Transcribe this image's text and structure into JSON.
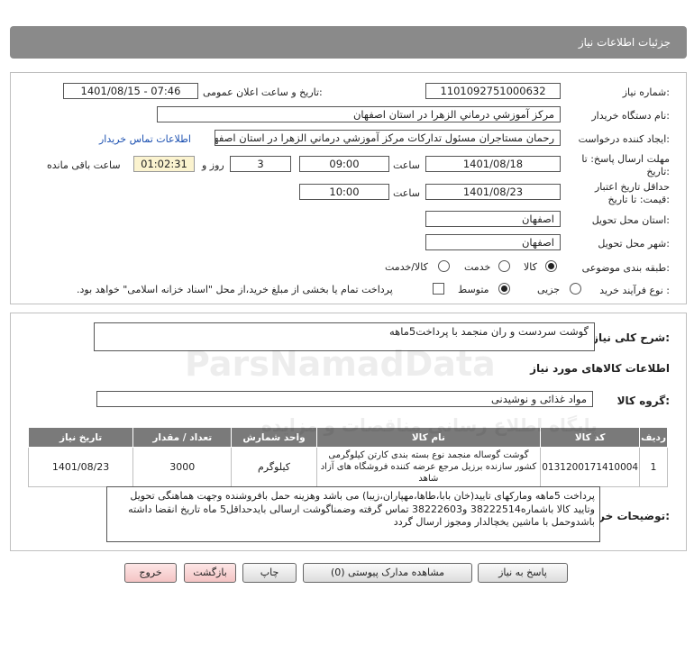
{
  "header": {
    "title": "جزئیات اطلاعات نیاز"
  },
  "form": {
    "need_number_label": "شماره نیاز:",
    "need_number": "1101092751000632",
    "announce_label": "تاریخ و ساعت اعلان عمومی:",
    "announce_value": "1401/08/15 - 07:46",
    "buyer_org_label": "نام دستگاه خریدار:",
    "buyer_org": "مرکز آموزشي درماني الزهرا در استان اصفهان",
    "creator_label": "ایجاد کننده درخواست:",
    "creator": "رحمان مستاجران مسئول تداركات مركز آموزشي درماني الزهرا در استان اصفهان",
    "buyer_contact_link": "اطلاعات تماس خریدار",
    "deadline_label_1": "مهلت ارسال پاسخ: تا",
    "deadline_label_2": "تاریخ:",
    "deadline_date": "1401/08/18",
    "time_label": "ساعت",
    "deadline_time": "09:00",
    "days_value": "3",
    "days_label": "روز و",
    "remaining_time": "01:02:31",
    "remaining_label": "ساعت باقی مانده",
    "validity_label_1": "حداقل تاریخ اعتبار",
    "validity_label_2": "قیمت: تا تاریخ:",
    "validity_date": "1401/08/23",
    "validity_time_label": "ساعت",
    "validity_time": "10:00",
    "delivery_province_label": "استان محل تحویل:",
    "delivery_province": "اصفهان",
    "delivery_city_label": "شهر محل تحویل:",
    "delivery_city": "اصفهان",
    "category_label": "طبقه بندی موضوعی:",
    "category_options": [
      "کالا",
      "خدمت",
      "کالا/خدمت"
    ],
    "process_label": "نوع فرآیند خرید :",
    "process_options": [
      "جزیی",
      "متوسط"
    ],
    "payment_note": "پرداخت تمام یا بخشی از مبلغ خرید،از محل \"اسناد خزانه اسلامی\" خواهد بود."
  },
  "need_section": {
    "summary_label": "شرح کلی نیاز:",
    "summary": "گوشت سردست و ران منجمد با پرداخت5ماهه",
    "items_info_title": "اطلاعات کالاهای مورد نیاز",
    "group_label": "گروه کالا:",
    "group_value": "مواد غذائی و نوشیدنی",
    "table_headers": [
      "ردیف",
      "کد کالا",
      "نام کالا",
      "واحد شمارش",
      "تعداد / مقدار",
      "تاریخ نیاز"
    ],
    "rows": [
      {
        "index": "1",
        "code": "0131200171410004",
        "name": "گوشت گوساله منجمد نوع بسته بندی کارتن کیلوگرمی کشور سازنده برزیل مرجع عرضه کننده فروشگاه های آزاد شاهد",
        "unit": "کیلوگرم",
        "qty": "3000",
        "date": "1401/08/23"
      }
    ],
    "buyer_desc_label": "توضیحات خریدار:",
    "buyer_desc": "پرداخت 5ماهه ومارکهای تایید(خان بابا،طاها،مهپاران،زیبا) می باشد وهزینه حمل بافروشنده وجهت هماهنگی تحویل وتایید کالا باشماره38222514 و38222603 تماس گرفته وضمناگوشت ارسالی بایدحداقل5 ماه تاریخ انقضا داشته باشدوحمل با ماشین یخچالدار ومجوز ارسال گردد"
  },
  "buttons": {
    "reply": "پاسخ به نیاز",
    "attachments": "مشاهده مدارک پیوستی (0)",
    "print": "چاپ",
    "back": "بازگشت",
    "exit": "خروج"
  },
  "watermark": {
    "line1": "ParsNamadData",
    "line2": "پایگاه اطلاع رسانی مناقصات و مزایده"
  }
}
